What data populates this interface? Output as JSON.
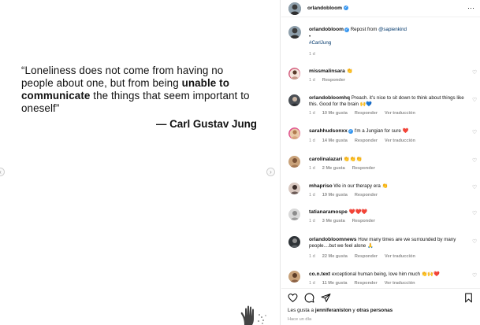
{
  "post": {
    "quote_part1": "“Loneliness does not come from having no people about one, but from being ",
    "quote_bold1": "unable to communicate",
    "quote_part2": " the things that seem important to oneself”",
    "author": "— Carl Gustav Jung",
    "prev_arrow": "‹",
    "next_arrow": "›"
  },
  "header": {
    "username": "orlandobloom",
    "more": "⋯"
  },
  "caption": {
    "username": "orlandobloom",
    "repost_text": "Repost from ",
    "repost_link": "@sapienkind",
    "bullet": "•",
    "hashtag": "#CarlJung",
    "time": "1 d"
  },
  "comments": [
    {
      "username": "missmalinsara",
      "verified": false,
      "text": "👏",
      "time": "1 d",
      "likes": "",
      "reply": "Responder",
      "translate": ""
    },
    {
      "username": "orlandobloomhq",
      "verified": false,
      "text": "Preach. it's nice to sit down to think about things like this. Good for the brain 🙌💙",
      "time": "1 d",
      "likes": "10 Me gusta",
      "reply": "Responder",
      "translate": "Ver traducción"
    },
    {
      "username": "sarahhudsonxx",
      "verified": true,
      "text": "I'm a Jungian for sure ❤️",
      "time": "1 d",
      "likes": "14 Me gusta",
      "reply": "Responder",
      "translate": "Ver traducción"
    },
    {
      "username": "carolinalazari",
      "verified": false,
      "text": "👏👏👏",
      "time": "1 d",
      "likes": "2 Me gusta",
      "reply": "Responder",
      "translate": ""
    },
    {
      "username": "mhapriso",
      "verified": false,
      "text": "We in our therapy era 👏",
      "time": "1 d",
      "likes": "19 Me gusta",
      "reply": "Responder",
      "translate": ""
    },
    {
      "username": "tatianaramospe",
      "verified": false,
      "text": "❤️❤️❤️",
      "time": "1 d",
      "likes": "3 Me gusta",
      "reply": "Responder",
      "translate": ""
    },
    {
      "username": "orlandobloomnews",
      "verified": false,
      "text": "How many times are we surrounded by many people....but we feel alone 🙏",
      "time": "1 d",
      "likes": "22 Me gusta",
      "reply": "Responder",
      "translate": "Ver traducción"
    },
    {
      "username": "co.n.text",
      "verified": false,
      "text": "exceptional human being, love him much 👏🙌❤️",
      "time": "1 d",
      "likes": "11 Me gusta",
      "reply": "Responder",
      "translate": "Ver traducción"
    }
  ],
  "footer": {
    "likes_prefix": "Les gusta a ",
    "likes_user": "jenniferaniston",
    "likes_mid": " y ",
    "likes_others": "otras personas",
    "ago": "Hace un día"
  },
  "icons": [
    "heart-icon",
    "comment-icon",
    "share-icon",
    "bookmark-icon",
    "verified-icon",
    "more-icon"
  ],
  "colors": {
    "verified": "#3897f0",
    "link": "#00376b",
    "meta": "#8e8e8e"
  }
}
